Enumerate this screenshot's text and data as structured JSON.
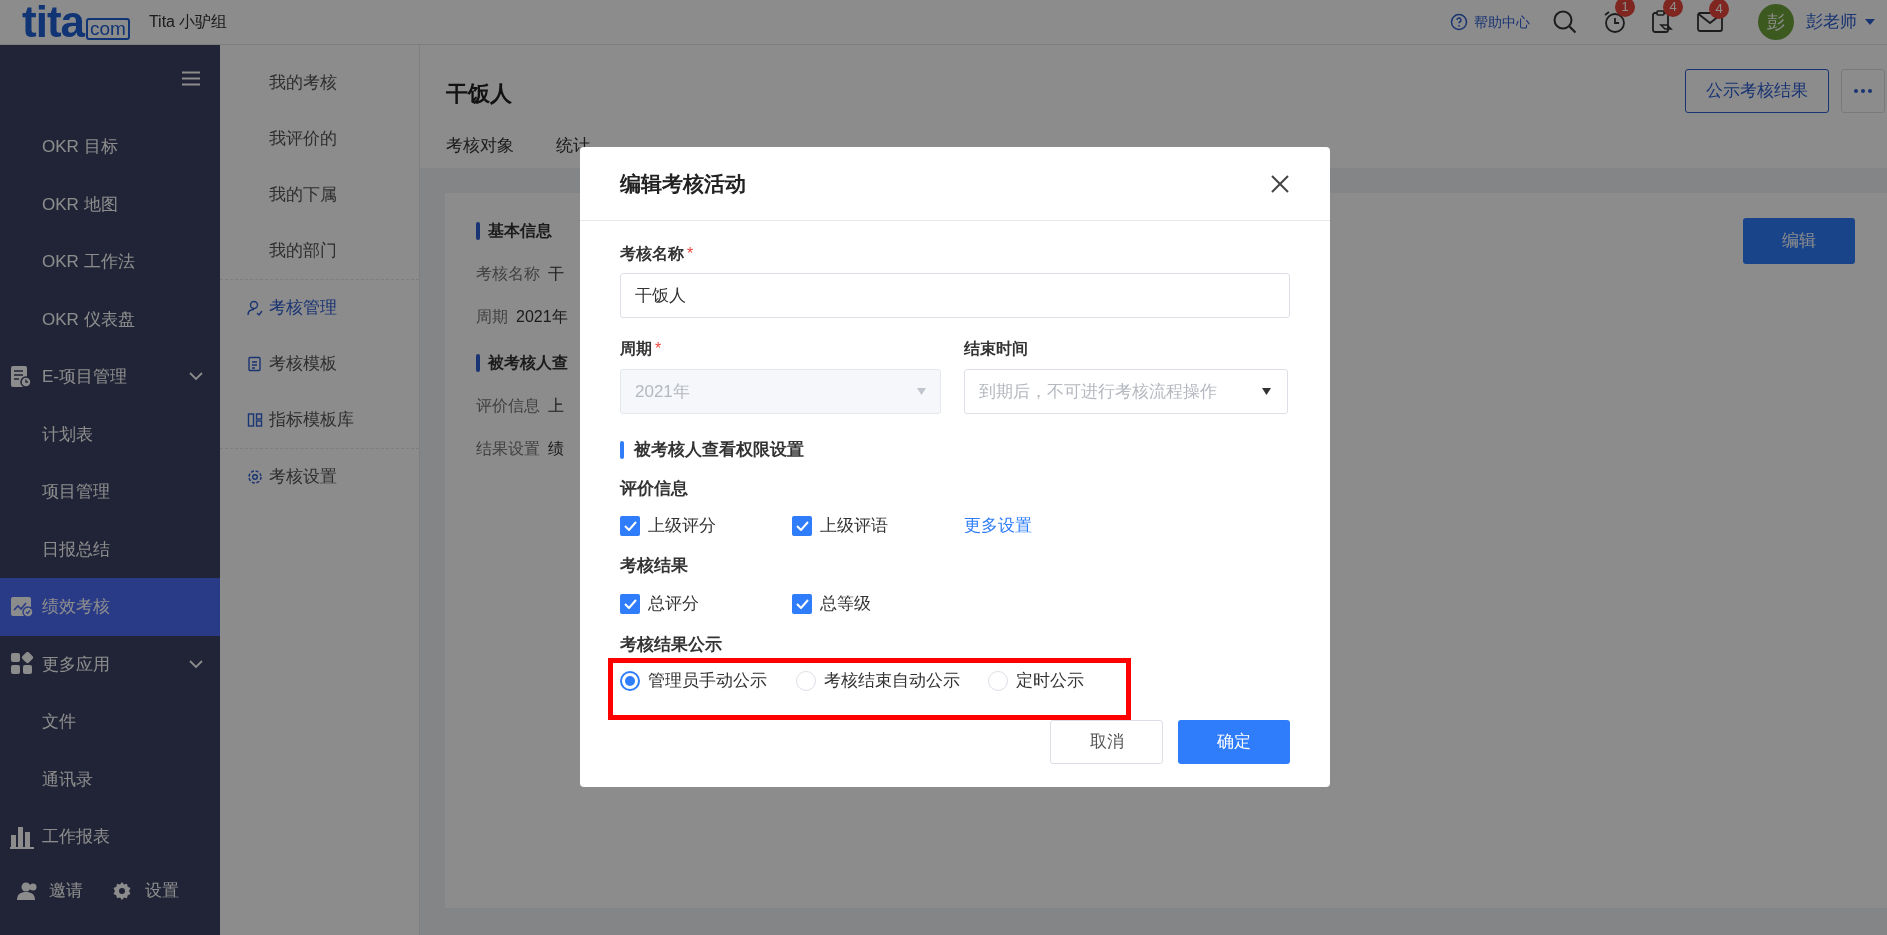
{
  "top_bar": {
    "logo": {
      "wordmark": "tita",
      "suffix": "com"
    },
    "org": "Tita 小驴组",
    "help": "帮助中心",
    "notifications": [
      {
        "kind": "alarm",
        "count": "1"
      },
      {
        "kind": "clipboard",
        "count": "4"
      },
      {
        "kind": "mail",
        "count": "4"
      }
    ],
    "user": {
      "avatar": "彭",
      "name": "彭老师"
    }
  },
  "sidebar": {
    "items": [
      {
        "label": "OKR 目标",
        "kind": "sub",
        "selected": false
      },
      {
        "label": "OKR 地图",
        "kind": "sub",
        "selected": false
      },
      {
        "label": "OKR 工作法",
        "kind": "sub",
        "selected": false
      },
      {
        "label": "OKR 仪表盘",
        "kind": "sub",
        "selected": false
      },
      {
        "label": "E-项目管理",
        "kind": "group",
        "expanded": true,
        "selected": false
      },
      {
        "label": "计划表",
        "kind": "sub",
        "selected": false
      },
      {
        "label": "项目管理",
        "kind": "sub",
        "selected": false
      },
      {
        "label": "日报总结",
        "kind": "sub",
        "selected": false
      },
      {
        "label": "绩效考核",
        "kind": "module",
        "selected": true
      },
      {
        "label": "更多应用",
        "kind": "group",
        "expanded": true,
        "selected": false
      },
      {
        "label": "文件",
        "kind": "sub",
        "selected": false
      },
      {
        "label": "通讯录",
        "kind": "sub",
        "selected": false
      },
      {
        "label": "工作报表",
        "kind": "module",
        "selected": false
      }
    ],
    "footer": [
      "邀请",
      "设置"
    ]
  },
  "sub_nav": [
    {
      "label": "我的考核",
      "divider_before": false,
      "selected": false
    },
    {
      "label": "我评价的",
      "divider_before": false,
      "selected": false
    },
    {
      "label": "我的下属",
      "divider_before": false,
      "selected": false
    },
    {
      "label": "我的部门",
      "divider_before": false,
      "selected": false
    },
    {
      "label": "考核管理",
      "divider_before": true,
      "selected": true
    },
    {
      "label": "考核模板",
      "divider_before": false,
      "selected": false
    },
    {
      "label": "指标模板库",
      "divider_before": false,
      "selected": false
    },
    {
      "label": "考核设置",
      "divider_before": true,
      "selected": false
    }
  ],
  "main": {
    "title": "干饭人",
    "publish_button": "公示考核结果",
    "tabs": [
      {
        "label": "考核对象",
        "selected": false
      },
      {
        "label": "统计",
        "selected": false
      }
    ],
    "card": {
      "edit_button": "编辑",
      "sections": [
        {
          "title": "基本信息",
          "rows": [
            {
              "label": "考核名称",
              "value": "干"
            },
            {
              "label": "周期",
              "value": "2021年"
            }
          ]
        },
        {
          "title": "被考核人查",
          "rows": [
            {
              "label": "评价信息",
              "value": "上"
            },
            {
              "label": "结果设置",
              "value": "绩"
            }
          ]
        }
      ]
    }
  },
  "dialog": {
    "title": "编辑考核活动",
    "name_field": {
      "label": "考核名称",
      "required_mark": "*",
      "value": "干饭人"
    },
    "period_field": {
      "label": "周期",
      "required_mark": "*",
      "value": "2021年",
      "disabled": true
    },
    "end_field": {
      "label": "结束时间",
      "placeholder": "到期后，不可进行考核流程操作"
    },
    "section": "被考核人查看权限设置",
    "groups": [
      {
        "title": "评价信息",
        "options": [
          {
            "label": "上级评分",
            "checked": true
          },
          {
            "label": "上级评语",
            "checked": true
          }
        ],
        "link": "更多设置"
      },
      {
        "title": "考核结果",
        "options": [
          {
            "label": "总评分",
            "checked": true
          },
          {
            "label": "总等级",
            "checked": true
          }
        ]
      }
    ],
    "publish": {
      "title": "考核结果公示",
      "options": [
        {
          "label": "管理员手动公示",
          "selected": true
        },
        {
          "label": "考核结束自动公示",
          "selected": false
        },
        {
          "label": "定时公示",
          "selected": false
        }
      ]
    },
    "buttons": {
      "cancel": "取消",
      "ok": "确定"
    }
  },
  "highlight": {
    "kind": "frame"
  }
}
